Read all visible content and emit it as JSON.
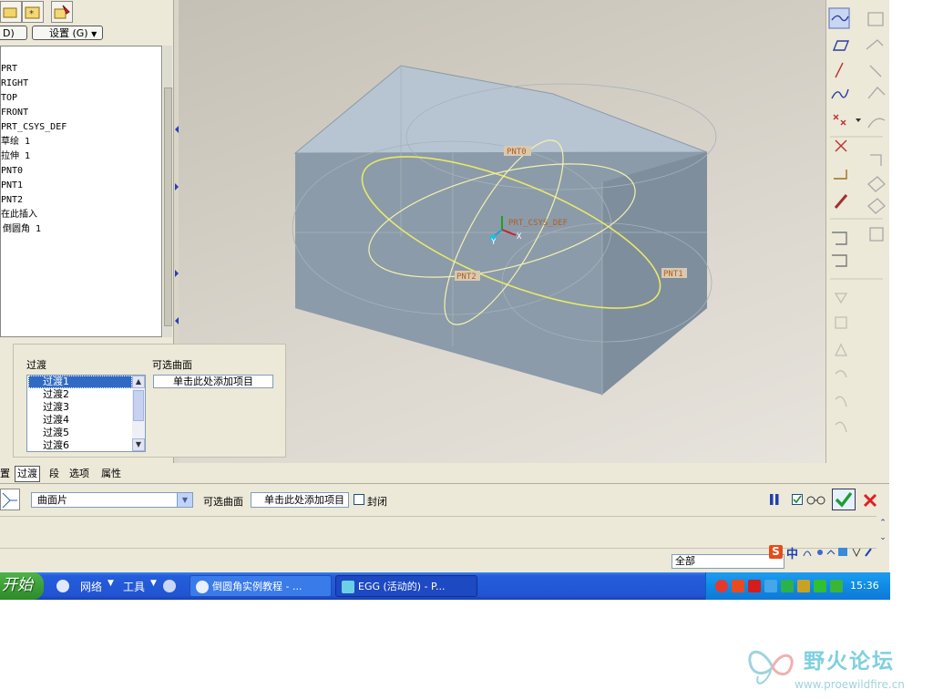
{
  "model_tree": {
    "settings_dropdown": "设置 (G)",
    "show_dropdown": "D)",
    "items": [
      "PRT",
      "RIGHT",
      "TOP",
      "FRONT",
      "PRT_CSYS_DEF",
      "草绘 1",
      "拉伸 1",
      "PNT0",
      "PNT1",
      "PNT2",
      "在此插入",
      "倒圆角 1"
    ]
  },
  "viewport": {
    "labels": {
      "pnt0": "PNT0",
      "pnt1": "PNT1",
      "pnt2": "PNT2",
      "csys": "PRT_CSYS_DEF",
      "axis_x": "X",
      "axis_y": "Y"
    }
  },
  "transition_panel": {
    "list_header": "过渡",
    "items": [
      "过渡1",
      "过渡2",
      "过渡3",
      "过渡4",
      "过渡5",
      "过渡6"
    ],
    "selected_index": 0,
    "optional_surfaces_header": "可选曲面",
    "add_item_text": "单击此处添加项目"
  },
  "dashboard": {
    "tabs": [
      "置",
      "过渡",
      "段",
      "选项",
      "属性"
    ],
    "active_tab_index": 1,
    "surface_type": "曲面片",
    "optional_surfaces_label": "可选曲面",
    "optional_surfaces_value": "单击此处添加项目",
    "closed_label": "封闭",
    "closed_checked": false,
    "preview_checked": true
  },
  "status_bar": {
    "filter_value": "全部"
  },
  "ime": {
    "chinese_label": "中"
  },
  "taskbar": {
    "start_label": "开始",
    "quick_launch": [
      "网络",
      "工具"
    ],
    "tasks": [
      "倒圆角实例教程 - ...",
      "EGG (活动的) - P..."
    ],
    "clock": "15:36"
  },
  "watermark": {
    "title": "野火论坛",
    "url": "www.proewildfire.cn"
  },
  "colors": {
    "taskbar_blue": "#245edb",
    "start_green": "#3a9b35",
    "selection_blue": "#316ac5",
    "cancel_red": "#e02020",
    "confirm_green": "#1e9e2e",
    "box_top": "#b7c5d2",
    "box_side": "#8898a6"
  }
}
